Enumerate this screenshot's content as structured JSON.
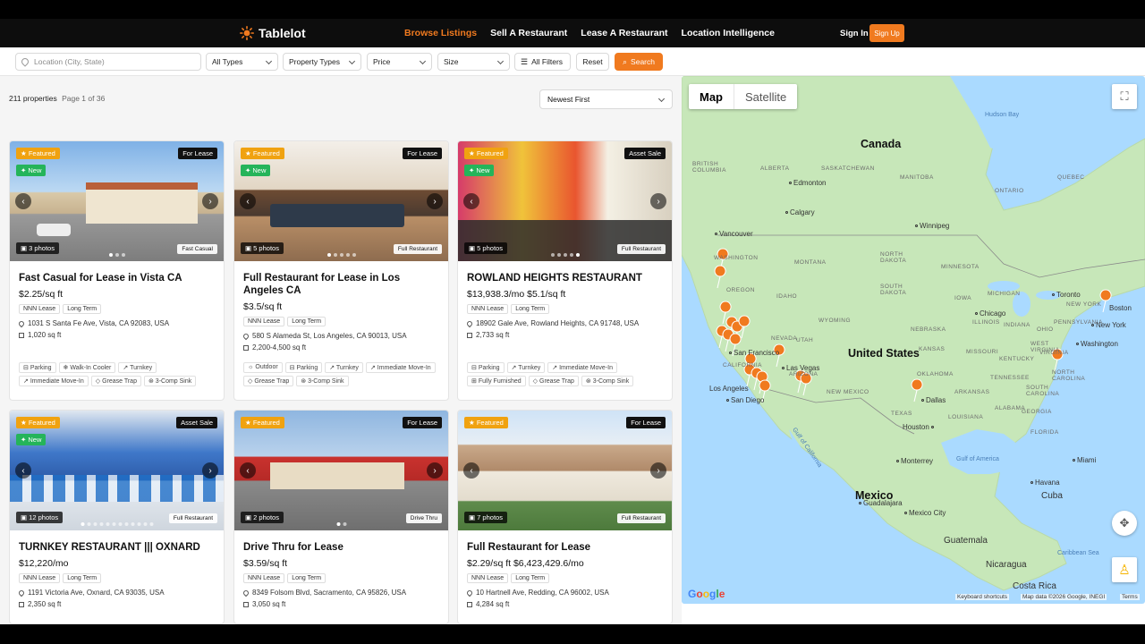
{
  "app": {
    "brand": "Tablelot"
  },
  "nav": {
    "links": [
      "Browse Listings",
      "Sell A Restaurant",
      "Lease A Restaurant",
      "Location Intelligence"
    ],
    "sign_in": "Sign In",
    "sign_up": "Sign Up",
    "accent": "#f07a1f"
  },
  "filters": {
    "location_placeholder": "Location (City, State)",
    "types": "All Types",
    "property_types": "Property Types",
    "price": "Price",
    "size": "Size",
    "all_filters": "All Filters",
    "reset": "Reset",
    "search": "Search"
  },
  "results": {
    "count": "211 properties",
    "page": "Page 1 of 36",
    "sort": "Newest First"
  },
  "listings": [
    {
      "featured": "Featured",
      "new": "New",
      "type": "For Lease",
      "photos": "3 photos",
      "category": "Fast Casual",
      "title": "Fast Casual for Lease in Vista CA",
      "price": "$2.25/sq ft",
      "tags": [
        "NNN Lease",
        "Long Term"
      ],
      "address": "1031 S Santa Fe Ave, Vista, CA 92083, USA",
      "sqft": "1,020 sq ft",
      "amenities": [
        "Parking",
        "Walk-In Cooler",
        "Turnkey",
        "Immediate Move-In",
        "Grease Trap",
        "3-Comp Sink"
      ]
    },
    {
      "featured": "Featured",
      "new": "New",
      "type": "For Lease",
      "photos": "5 photos",
      "category": "Full Restaurant",
      "title": "Full Restaurant for Lease in Los Angeles CA",
      "price": "$3.5/sq ft",
      "tags": [
        "NNN Lease",
        "Long Term"
      ],
      "address": "580 S Alameda St, Los Angeles, CA 90013, USA",
      "sqft": "2,200-4,500 sq ft",
      "amenities": [
        "Outdoor",
        "Parking",
        "Turnkey",
        "Immediate Move-In",
        "Grease Trap",
        "3-Comp Sink"
      ]
    },
    {
      "featured": "Featured",
      "new": "New",
      "type": "Asset Sale",
      "photos": "5 photos",
      "category": "Full Restaurant",
      "title": "ROWLAND HEIGHTS RESTAURANT",
      "price": "$13,938.3/mo  $5.1/sq ft",
      "tags": [
        "NNN Lease",
        "Long Term"
      ],
      "address": "18902 Gale Ave, Rowland Heights, CA 91748, USA",
      "sqft": "2,733 sq ft",
      "amenities": [
        "Parking",
        "Turnkey",
        "Immediate Move-In",
        "Fully Furnished",
        "Grease Trap",
        "3-Comp Sink"
      ]
    },
    {
      "featured": "Featured",
      "new": "New",
      "type": "Asset Sale",
      "photos": "12 photos",
      "category": "Full Restaurant",
      "title": "TURNKEY RESTAURANT ||| OXNARD",
      "price": "$12,220/mo",
      "tags": [
        "NNN Lease",
        "Long Term"
      ],
      "address": "1191 Victoria Ave, Oxnard, CA 93035, USA",
      "sqft": "2,350 sq ft",
      "amenities": []
    },
    {
      "featured": "Featured",
      "new": "",
      "type": "For Lease",
      "photos": "2 photos",
      "category": "Drive Thru",
      "title": "Drive Thru for Lease",
      "price": "$3.59/sq ft",
      "tags": [
        "NNN Lease",
        "Long Term"
      ],
      "address": "8349 Folsom Blvd, Sacramento, CA 95826, USA",
      "sqft": "3,050 sq ft",
      "amenities": []
    },
    {
      "featured": "Featured",
      "new": "",
      "type": "For Lease",
      "photos": "7 photos",
      "category": "Full Restaurant",
      "title": "Full Restaurant for Lease",
      "price": "$2.29/sq ft  $6,423,429.6/mo",
      "tags": [
        "NNN Lease",
        "Long Term"
      ],
      "address": "10 Hartnell Ave, Redding, CA 96002, USA",
      "sqft": "4,284 sq ft",
      "amenities": []
    }
  ],
  "map": {
    "tabs": [
      "Map",
      "Satellite"
    ],
    "countries": [
      "Canada",
      "United States",
      "Mexico"
    ],
    "cities": [
      "Edmonton",
      "Calgary",
      "Vancouver",
      "Winnipeg",
      "San Francisco",
      "Las Vegas",
      "Los Angeles",
      "San Diego",
      "Dallas",
      "Houston",
      "Chicago",
      "Toronto",
      "Boston",
      "New York",
      "Washington",
      "Monterrey",
      "Guadalajara",
      "Mexico City",
      "Miami",
      "Havana",
      "Cuba",
      "Guatemala",
      "Nicaragua",
      "Costa Rica"
    ],
    "water": [
      "Hudson Bay",
      "Gulf of America",
      "Gulf of California",
      "Caribbean Sea"
    ],
    "footer": {
      "shortcuts": "Keyboard shortcuts",
      "data": "Map data ©2026 Google, INEGI",
      "terms": "Terms"
    },
    "logo": "Google"
  }
}
